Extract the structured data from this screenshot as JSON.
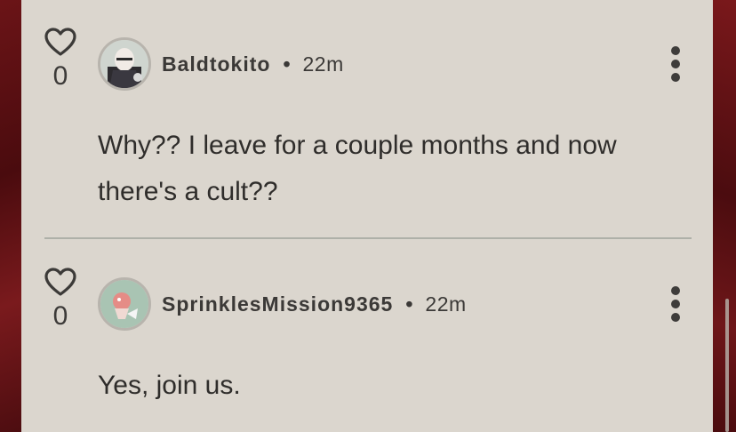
{
  "comments": [
    {
      "username": "Baldtokito",
      "separator": "•",
      "time": "22m",
      "votes": "0",
      "body": "Why?? I leave for a couple months and now there's a cult??",
      "avatar_color": "#c9cfc9"
    },
    {
      "username": "SprinklesMission9365",
      "separator": "•",
      "time": "22m",
      "votes": "0",
      "body": "Yes, join us.",
      "avatar_color": "#a9c4b3"
    }
  ],
  "colors": {
    "panel": "#dbd6ce",
    "background": "#5a0f12",
    "text": "#2f2d2b",
    "divider": "#aeb0a8"
  },
  "icons": [
    "heart-icon",
    "more-options-icon"
  ]
}
